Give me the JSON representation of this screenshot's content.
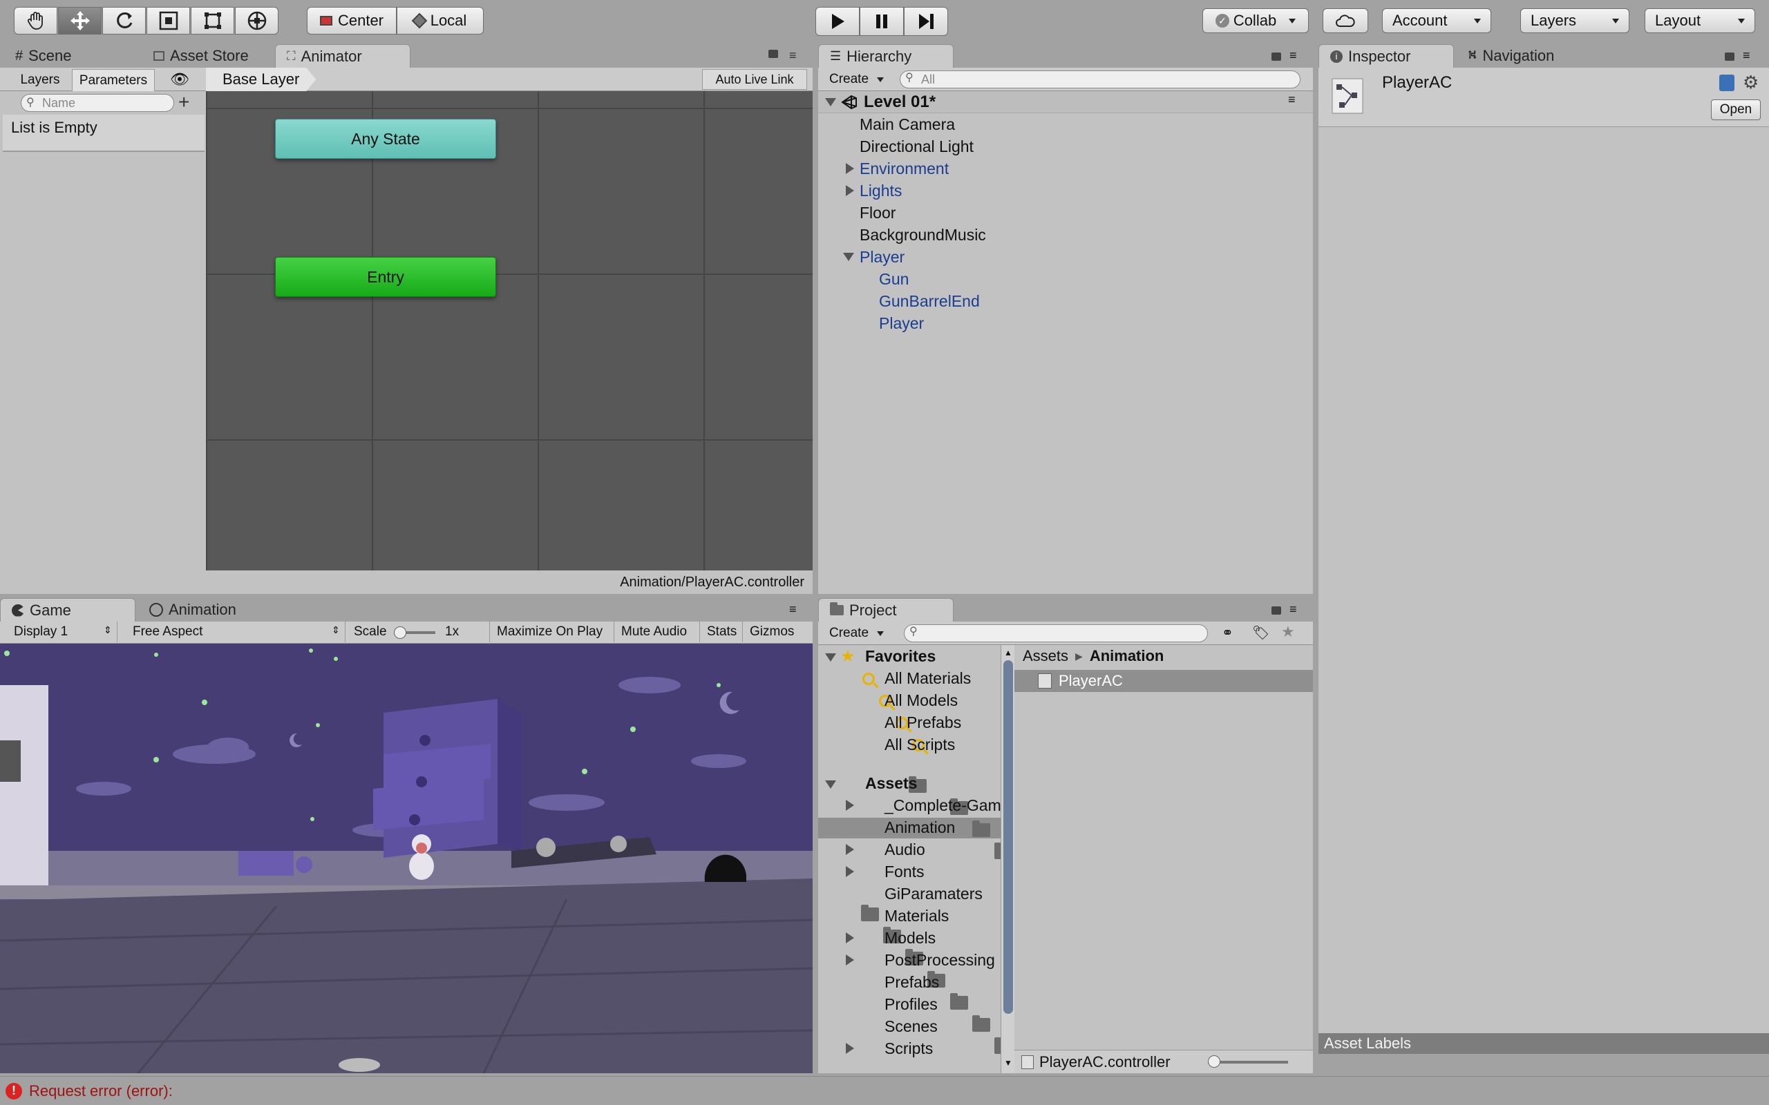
{
  "toolbar": {
    "tools": [
      "hand-icon",
      "move-icon",
      "rotate-icon",
      "scale-icon",
      "rect-icon",
      "transform-icon"
    ],
    "pivot_mode": "Center",
    "pivot_rotation": "Local",
    "collab": "Collab",
    "account": "Account",
    "layers": "Layers",
    "layout": "Layout"
  },
  "top_left_tabs": [
    "Scene",
    "Asset Store",
    "Animator"
  ],
  "animator": {
    "side_tabs": [
      "Layers",
      "Parameters"
    ],
    "search_placeholder": "Name",
    "empty_text": "List is Empty",
    "breadcrumb": "Base Layer",
    "auto_live_link": "Auto Live Link",
    "states": {
      "any": "Any State",
      "entry": "Entry"
    },
    "footer_path": "Animation/PlayerAC.controller"
  },
  "hierarchy": {
    "tab": "Hierarchy",
    "create": "Create",
    "search_placeholder": "All",
    "scene": "Level 01*",
    "items": [
      {
        "label": "Main Camera"
      },
      {
        "label": "Directional Light"
      },
      {
        "label": "Environment"
      },
      {
        "label": "Lights"
      },
      {
        "label": "Floor"
      },
      {
        "label": "BackgroundMusic"
      },
      {
        "label": "Player"
      },
      {
        "label": "Gun"
      },
      {
        "label": "GunBarrelEnd"
      },
      {
        "label": "Player"
      }
    ]
  },
  "inspector": {
    "tabs": [
      "Inspector",
      "Navigation"
    ],
    "asset_name": "PlayerAC",
    "open_button": "Open",
    "asset_labels": "Asset Labels"
  },
  "game": {
    "tabs": [
      "Game",
      "Animation"
    ],
    "display": "Display 1",
    "aspect": "Free Aspect",
    "scale_label": "Scale",
    "scale_value": "1x",
    "maximize": "Maximize On Play",
    "mute": "Mute Audio",
    "stats": "Stats",
    "gizmos": "Gizmos"
  },
  "project": {
    "tab": "Project",
    "create": "Create",
    "favorites_title": "Favorites",
    "favorites": [
      "All Materials",
      "All Models",
      "All Prefabs",
      "All Scripts"
    ],
    "assets_title": "Assets",
    "folders": [
      {
        "label": "_Complete-Gam"
      },
      {
        "label": "Animation"
      },
      {
        "label": "Audio"
      },
      {
        "label": "Fonts"
      },
      {
        "label": "GiParamaters"
      },
      {
        "label": "Materials"
      },
      {
        "label": "Models"
      },
      {
        "label": "PostProcessing"
      },
      {
        "label": "Prefabs"
      },
      {
        "label": "Profiles"
      },
      {
        "label": "Scenes"
      },
      {
        "label": "Scripts"
      }
    ],
    "path": {
      "root": "Assets",
      "current": "Animation"
    },
    "selected_asset": "PlayerAC",
    "footer_file": "PlayerAC.controller"
  },
  "status_bar": {
    "message": "Request error (error):"
  }
}
